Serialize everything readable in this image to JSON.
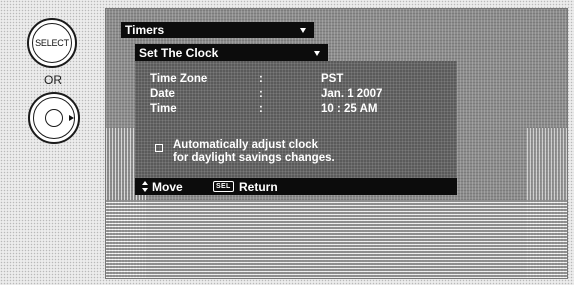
{
  "remote": {
    "select_label": "SELECT",
    "or_label": "OR"
  },
  "menu": {
    "timers_title": "Timers",
    "submenu_title": "Set The Clock",
    "settings": [
      {
        "label": "Time Zone",
        "separator": ":",
        "value": "PST"
      },
      {
        "label": "Date",
        "separator": ":",
        "value": "Jan. 1 2007"
      },
      {
        "label": "Time",
        "separator": ":",
        "value": "10 : 25 AM"
      }
    ],
    "dst": {
      "checked": false,
      "line1": "Automatically adjust clock",
      "line2": "for daylight savings changes."
    }
  },
  "help_bar": {
    "move_label": "Move",
    "sel_badge": "SEL",
    "return_label": "Return"
  }
}
